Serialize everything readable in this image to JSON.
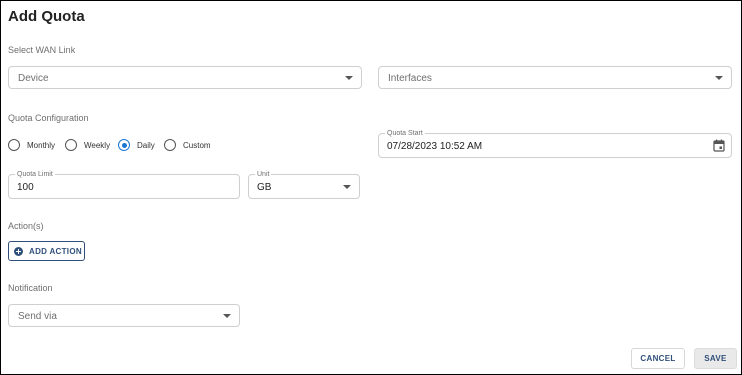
{
  "dialog": {
    "title": "Add Quota"
  },
  "wan": {
    "section_label": "Select WAN Link",
    "device_placeholder": "Device",
    "interfaces_placeholder": "Interfaces"
  },
  "quota_config": {
    "section_label": "Quota Configuration",
    "options": [
      {
        "label": "Monthly",
        "checked": false
      },
      {
        "label": "Weekly",
        "checked": false
      },
      {
        "label": "Daily",
        "checked": true
      },
      {
        "label": "Custom",
        "checked": false
      }
    ],
    "quota_start": {
      "label": "Quota Start",
      "value": "07/28/2023 10:52 AM",
      "icon": "calendar-icon"
    },
    "quota_limit": {
      "label": "Quota Limit",
      "value": "100"
    },
    "unit": {
      "label": "Unit",
      "value": "GB"
    }
  },
  "actions": {
    "section_label": "Action(s)",
    "add_label": "ADD ACTION",
    "add_icon": "plus-circle-icon"
  },
  "notification": {
    "section_label": "Notification",
    "send_via_placeholder": "Send via"
  },
  "footer": {
    "cancel_label": "CANCEL",
    "save_label": "SAVE"
  },
  "colors": {
    "accent": "#1976d2",
    "button_text": "#2f4f7a",
    "border": "#cfcfcf"
  }
}
